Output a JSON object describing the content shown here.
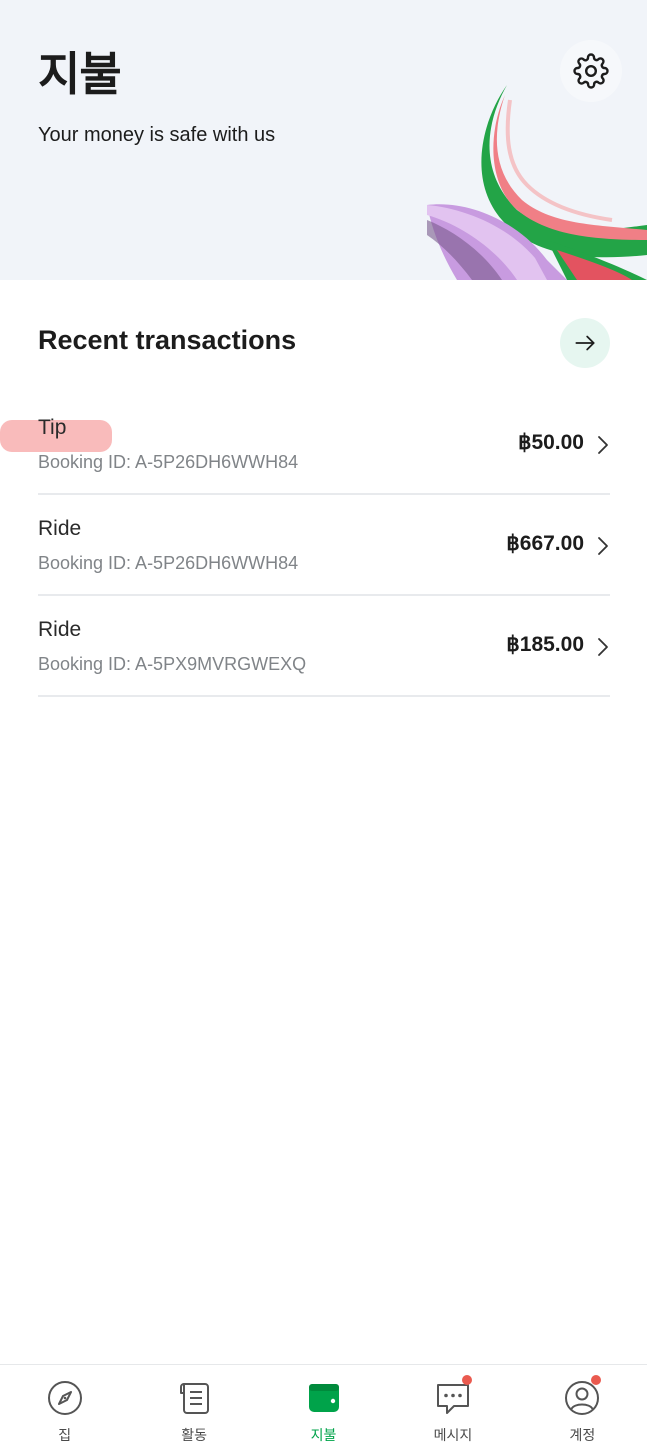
{
  "header": {
    "title": "지불",
    "subtitle": "Your money is safe with us",
    "settings_icon": "gear-icon"
  },
  "recent": {
    "title": "Recent transactions",
    "more_icon": "arrow-right-icon"
  },
  "transactions": [
    {
      "type": "Tip",
      "booking": "Booking ID: A-5P26DH6WWH84",
      "amount": "฿50.00"
    },
    {
      "type": "Ride",
      "booking": "Booking ID: A-5P26DH6WWH84",
      "amount": "฿667.00"
    },
    {
      "type": "Ride",
      "booking": "Booking ID: A-5PX9MVRGWEXQ",
      "amount": "฿185.00"
    }
  ],
  "nav": {
    "items": [
      {
        "label": "집",
        "icon": "compass-icon",
        "active": false
      },
      {
        "label": "활동",
        "icon": "receipt-icon",
        "active": false
      },
      {
        "label": "지불",
        "icon": "wallet-icon",
        "active": true
      },
      {
        "label": "메시지",
        "icon": "chat-icon",
        "active": false,
        "badge": true
      },
      {
        "label": "계정",
        "icon": "account-icon",
        "active": false,
        "badge": true
      }
    ]
  },
  "colors": {
    "accent_green": "#00a34a",
    "header_bg": "#f1f4f9",
    "badge_red": "#ea5a4f",
    "highlight": "#f7a4a4"
  }
}
